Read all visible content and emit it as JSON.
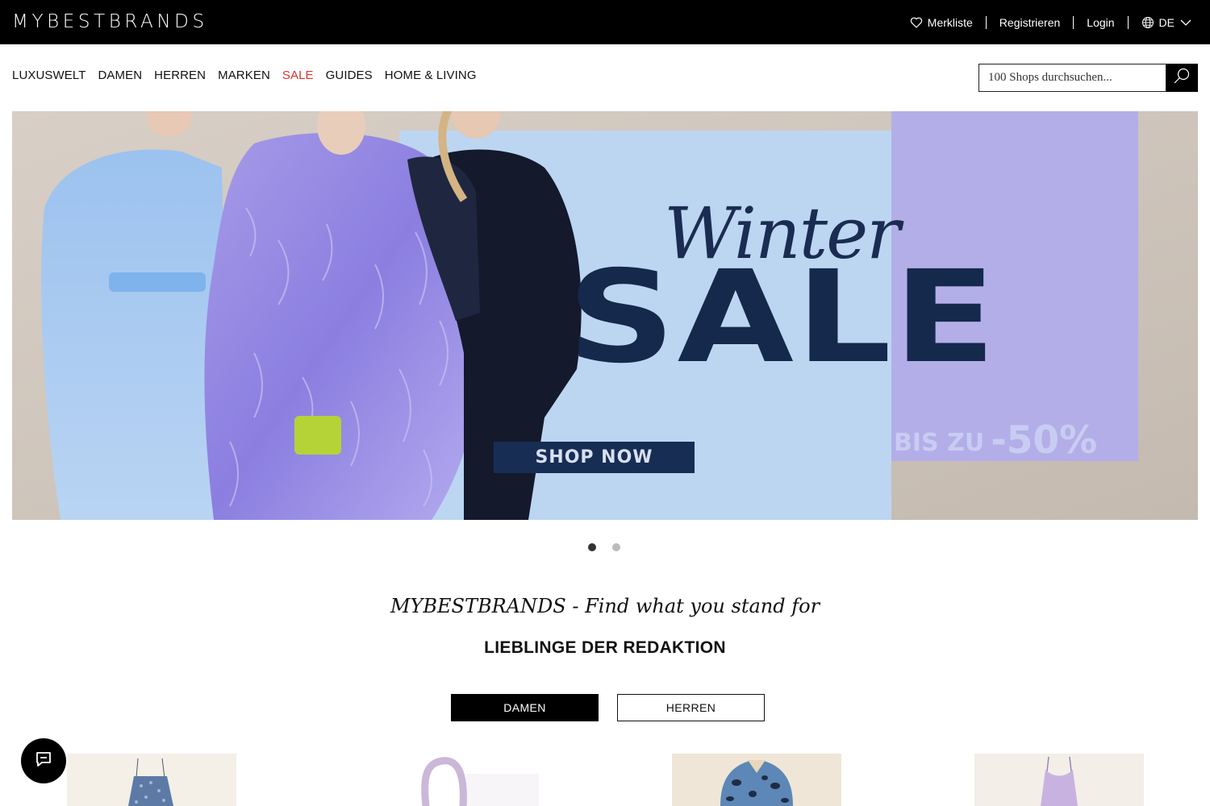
{
  "brand": {
    "logo_text": "MYBESTBRANDS"
  },
  "topbar": {
    "wishlist_label": "Merkliste",
    "register_label": "Registrieren",
    "login_label": "Login",
    "language_label": "DE",
    "icons": [
      "heart-icon",
      "globe-icon",
      "chevron-down-icon"
    ]
  },
  "nav": {
    "items": [
      {
        "label": "LUXUSWELT"
      },
      {
        "label": "DAMEN"
      },
      {
        "label": "HERREN"
      },
      {
        "label": "MARKEN"
      },
      {
        "label": "SALE",
        "color": "#e0322c"
      },
      {
        "label": "GUIDES"
      },
      {
        "label": "HOME & LIVING"
      }
    ]
  },
  "search": {
    "placeholder": "100 Shops durchsuchen...",
    "icon": "search-icon"
  },
  "hero": {
    "script_text": "Winter",
    "headline": "SALE",
    "discount_prefix": "BIS ZU",
    "discount_value": "-50%",
    "cta_label": "SHOP NOW",
    "slide_count": 2,
    "active_slide": 1,
    "colors": {
      "navy": "#15294c",
      "light_blue": "#bcd6f2",
      "lavender": "#b3aee8"
    }
  },
  "tagline": "MYBESTBRANDS - Find what you stand for",
  "section_title": "LIEBLINGE DER REDAKTION",
  "gender_tabs": {
    "active": "DAMEN",
    "inactive": "HERREN"
  },
  "chat": {
    "icon": "chat-icon"
  }
}
